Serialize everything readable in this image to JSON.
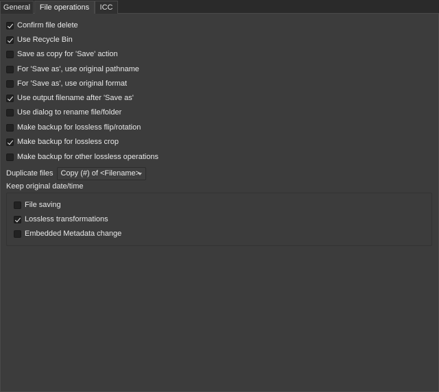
{
  "tabs": [
    {
      "label": "General",
      "active": false
    },
    {
      "label": "File operations",
      "active": true
    },
    {
      "label": "ICC",
      "active": false
    }
  ],
  "options": [
    {
      "label": "Confirm file delete",
      "checked": true
    },
    {
      "label": "Use Recycle Bin",
      "checked": true
    },
    {
      "label": "Save as copy for 'Save' action",
      "checked": false
    },
    {
      "label": "For 'Save as', use original pathname",
      "checked": false
    },
    {
      "label": "For 'Save as', use original format",
      "checked": false
    },
    {
      "label": "Use output filename after 'Save as'",
      "checked": true
    },
    {
      "label": "Use dialog to rename file/folder",
      "checked": false
    },
    {
      "label": "Make backup for lossless flip/rotation",
      "checked": false
    },
    {
      "label": "Make backup for lossless crop",
      "checked": true
    },
    {
      "label": "Make backup for other lossless operations",
      "checked": false
    }
  ],
  "duplicate": {
    "label": "Duplicate files",
    "selected": "Copy (#) of <Filename>"
  },
  "keep_date": {
    "title": "Keep original date/time",
    "options": [
      {
        "label": "File saving",
        "checked": false
      },
      {
        "label": "Lossless transformations",
        "checked": true
      },
      {
        "label": "Embedded Metadata change",
        "checked": false
      }
    ]
  }
}
